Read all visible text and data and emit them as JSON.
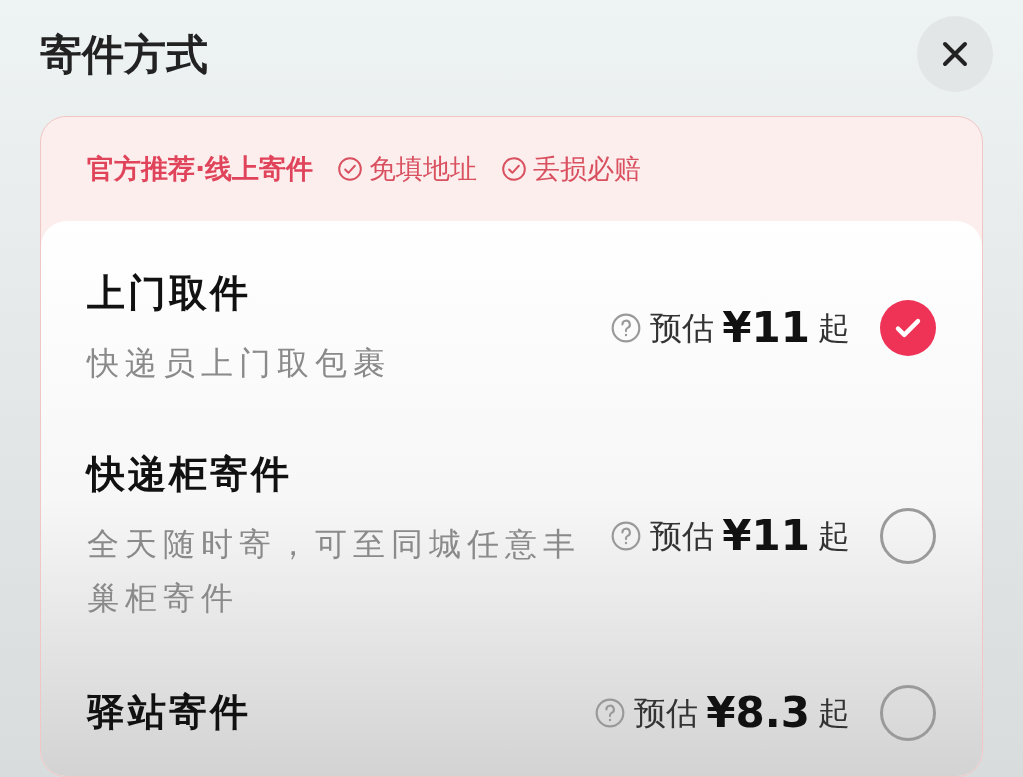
{
  "title": "寄件方式",
  "banner": {
    "headline": "官方推荐·线上寄件",
    "badges": [
      "免填地址",
      "丢损必赔"
    ]
  },
  "options": [
    {
      "name": "上门取件",
      "description": "快递员上门取包裹",
      "price_prefix": "预估",
      "price": "¥11",
      "price_suffix": "起",
      "selected": true
    },
    {
      "name": "快递柜寄件",
      "description": "全天随时寄，可至同城任意丰巢柜寄件",
      "price_prefix": "预估",
      "price": "¥11",
      "price_suffix": "起",
      "selected": false
    },
    {
      "name": "驿站寄件",
      "price_prefix": "预估",
      "price": "¥8.3",
      "price_suffix": "起",
      "selected": false
    }
  ]
}
